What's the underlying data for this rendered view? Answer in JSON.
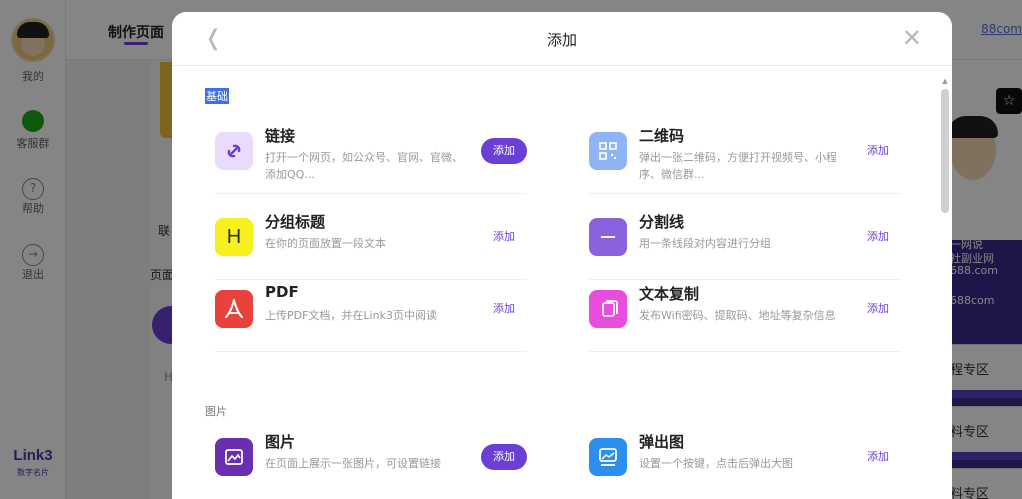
{
  "app": {
    "sidebar": {
      "items": [
        {
          "label": "我的"
        },
        {
          "label": "客服群"
        },
        {
          "label": "帮助"
        },
        {
          "label": "退出"
        }
      ],
      "brand": "Link3",
      "brand_sub": "数字名片"
    },
    "topbar": {
      "active_tab": "制作页面",
      "right_text": "88com"
    },
    "background_texts": [
      "联",
      "页面",
      "H"
    ],
    "right_panel": {
      "lines": [
        "网",
        "一网说",
        "社副业网",
        "688.com"
      ],
      "link": "688com",
      "sections": [
        "程专区",
        "料专区",
        "料专区"
      ]
    }
  },
  "modal": {
    "title": "添加",
    "sections": [
      {
        "label": "基础",
        "items": [
          {
            "title": "链接",
            "desc": "打开一个网页，如公众号、官网、官微、添加QQ...",
            "add": "添加",
            "icon": "link-icon",
            "color": "#e9dcfb",
            "fg": "#6b3fd6",
            "filled": true
          },
          {
            "title": "二维码",
            "desc": "弹出一张二维码，方便打开视频号、小程序、微信群...",
            "add": "添加",
            "icon": "qrcode-icon",
            "color": "#8fb4f5",
            "fg": "#ffffff",
            "filled": false
          },
          {
            "title": "分组标题",
            "desc": "在你的页面放置一段文本",
            "add": "添加",
            "icon": "heading-icon",
            "color": "#f5f01e",
            "fg": "#333333",
            "filled": false
          },
          {
            "title": "分割线",
            "desc": "用一条线段对内容进行分组",
            "add": "添加",
            "icon": "divider-icon",
            "color": "#8a62e0",
            "fg": "#ffffff",
            "filled": false
          },
          {
            "title": "PDF",
            "desc": "上传PDF文档，并在Link3页中阅读",
            "add": "添加",
            "icon": "pdf-icon",
            "color": "#e8423a",
            "fg": "#ffffff",
            "filled": false
          },
          {
            "title": "文本复制",
            "desc": "发布Wifi密码、提取码、地址等复杂信息",
            "add": "添加",
            "icon": "copy-icon",
            "color": "#e84de0",
            "fg": "#ffffff",
            "filled": false
          }
        ]
      },
      {
        "label": "图片",
        "items": [
          {
            "title": "图片",
            "desc": "在页面上展示一张图片，可设置链接",
            "add": "添加",
            "icon": "image-icon",
            "color": "#6a2fb0",
            "fg": "#ffffff",
            "filled": true
          },
          {
            "title": "弹出图",
            "desc": "设置一个按键，点击后弹出大图",
            "add": "添加",
            "icon": "popup-image-icon",
            "color": "#2b8ff0",
            "fg": "#ffffff",
            "filled": false
          }
        ]
      }
    ]
  }
}
